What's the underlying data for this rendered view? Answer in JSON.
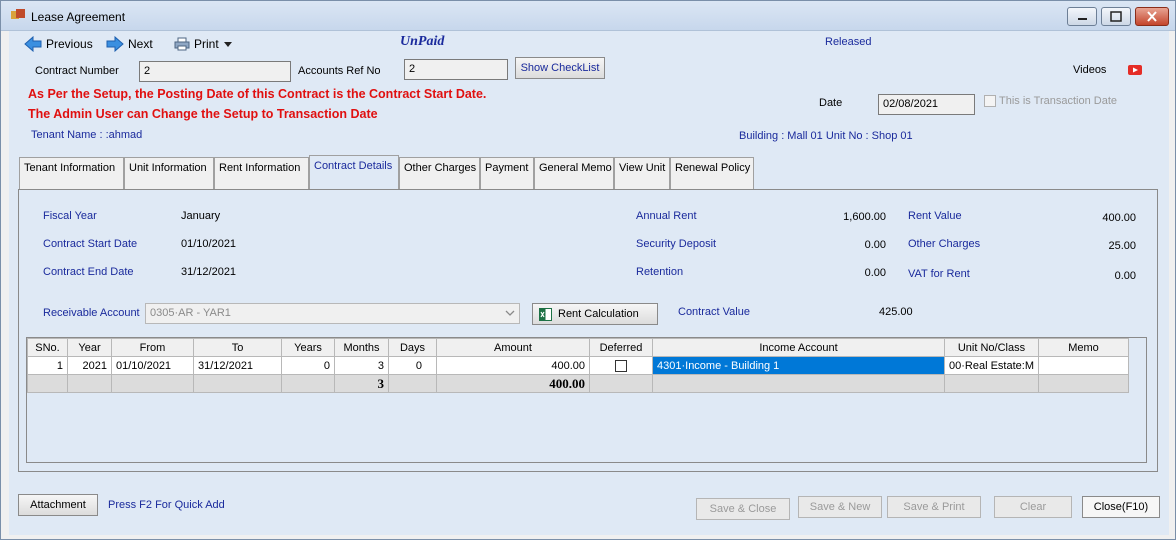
{
  "window": {
    "title": "Lease Agreement"
  },
  "toolbar": {
    "previous": "Previous",
    "next": "Next",
    "print": "Print"
  },
  "status": {
    "payment": "UnPaid",
    "state": "Released"
  },
  "fields": {
    "contract_number_label": "Contract Number",
    "contract_number": "2",
    "accounts_ref_label": "Accounts Ref No",
    "accounts_ref": "2",
    "show_checklist": "Show CheckList",
    "videos": "Videos",
    "date_label": "Date",
    "date": "02/08/2021",
    "transaction_date_label": "This is Transaction Date"
  },
  "notice": {
    "line1": "As Per the Setup, the Posting Date of this Contract is the Contract Start Date.",
    "line2": "The Admin User can Change the Setup to Transaction Date"
  },
  "tenant_name": "Tenant Name : :ahmad",
  "building_info": "Building : Mall 01  Unit No : Shop 01",
  "tabs": [
    "Tenant Information",
    "Unit Information",
    "Rent Information",
    "Contract Details",
    "Other Charges",
    "Payment",
    "General Memo",
    "View Unit",
    "Renewal Policy"
  ],
  "details": {
    "fiscal_year_label": "Fiscal Year",
    "fiscal_year": "January",
    "start_label": "Contract Start Date",
    "start": "01/10/2021",
    "end_label": "Contract End Date",
    "end": "31/12/2021",
    "annual_rent_label": "Annual Rent",
    "annual_rent": "1,600.00",
    "security_label": "Security Deposit",
    "security": "0.00",
    "retention_label": "Retention",
    "retention": "0.00",
    "rent_value_label": "Rent Value",
    "rent_value": "400.00",
    "other_charges_label": "Other Charges",
    "other_charges": "25.00",
    "vat_label": "VAT for Rent",
    "vat": "0.00",
    "receivable_label": "Receivable Account",
    "receivable": "0305·AR - YAR1",
    "rent_calc": "Rent Calculation",
    "contract_value_label": "Contract Value",
    "contract_value": "425.00"
  },
  "grid": {
    "headers": [
      "SNo.",
      "Year",
      "From",
      "To",
      "Years",
      "Months",
      "Days",
      "Amount",
      "Deferred",
      "Income Account",
      "Unit No/Class",
      "Memo"
    ],
    "row": {
      "sno": "1",
      "year": "2021",
      "from": "01/10/2021",
      "to": "31/12/2021",
      "years": "0",
      "months": "3",
      "days": "0",
      "amount": "400.00",
      "income_account": "4301·Income - Building 1",
      "unit_class": "00·Real Estate:M",
      "memo": ""
    },
    "totals": {
      "months": "3",
      "amount": "400.00"
    }
  },
  "footer": {
    "attachment": "Attachment",
    "hint": "Press F2 For Quick Add",
    "save_close": "Save & Close",
    "save_new": "Save & New",
    "save_print": "Save & Print",
    "clear": "Clear",
    "close": "Close(F10)"
  }
}
